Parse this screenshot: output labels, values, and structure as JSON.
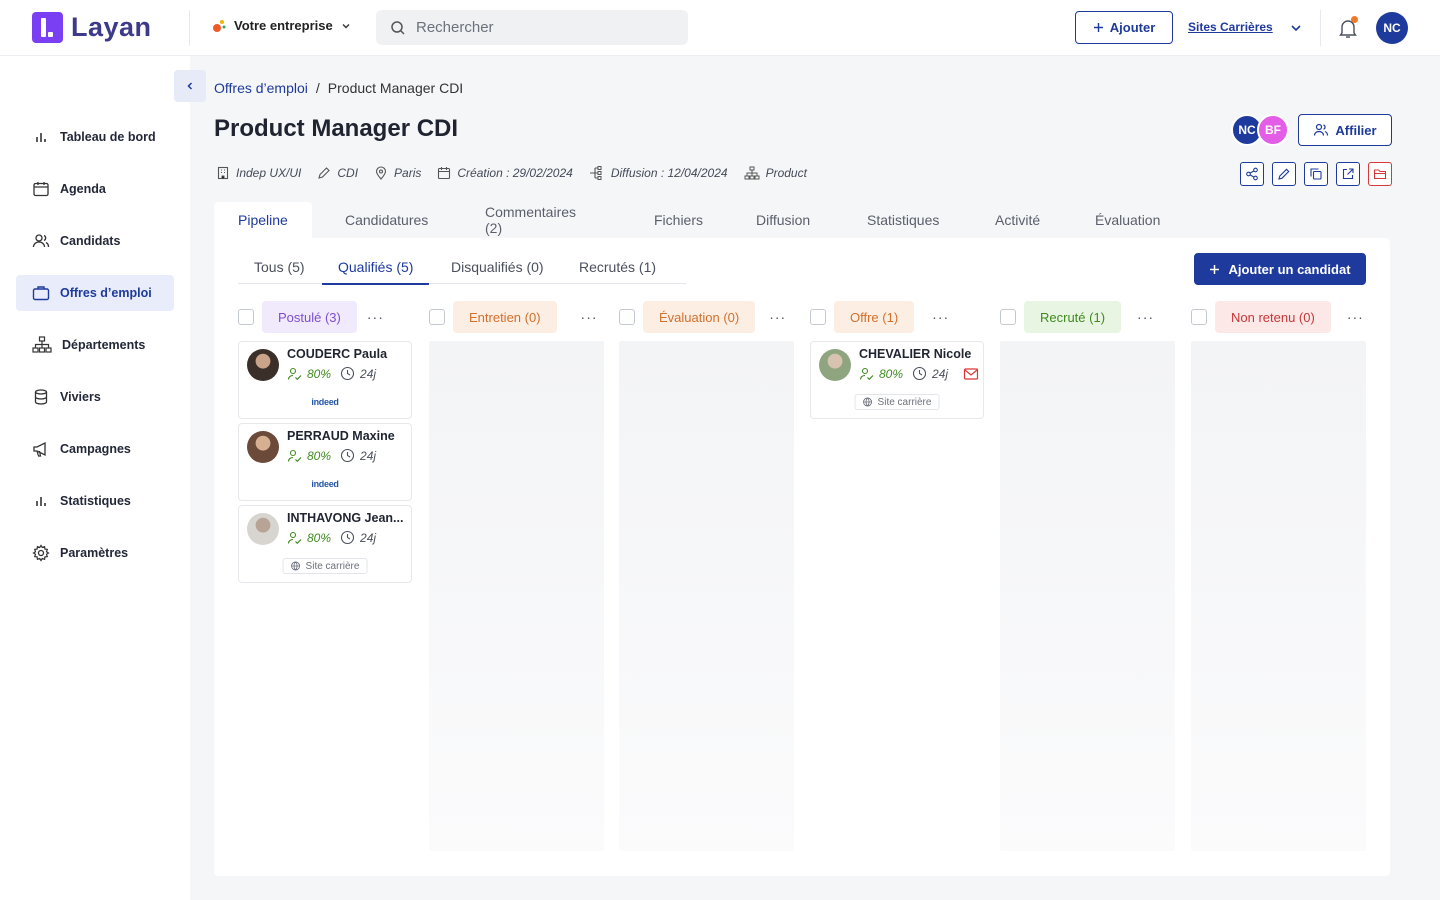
{
  "app": {
    "logo_text": "Layan",
    "brand_color": "#7a3ff2",
    "accent_color": "#1e3a9c"
  },
  "topbar": {
    "company": "Votre entreprise",
    "search_placeholder": "Rechercher",
    "add_label": "Ajouter",
    "sites_label": "Sites Carrières",
    "user_initials": "NC",
    "notification_dot": true
  },
  "sidebar": {
    "items": [
      {
        "label": "Tableau de bord",
        "icon": "bar-chart-icon"
      },
      {
        "label": "Agenda",
        "icon": "calendar-icon"
      },
      {
        "label": "Candidats",
        "icon": "users-icon"
      },
      {
        "label": "Offres d’emploi",
        "icon": "briefcase-icon",
        "active": true
      },
      {
        "label": "Départements",
        "icon": "org-chart-icon"
      },
      {
        "label": "Viviers",
        "icon": "database-icon"
      },
      {
        "label": "Campagnes",
        "icon": "megaphone-icon"
      },
      {
        "label": "Statistiques",
        "icon": "bar-chart-icon"
      },
      {
        "label": "Paramètres",
        "icon": "gear-icon"
      }
    ]
  },
  "breadcrumb": {
    "parent": "Offres d’emploi",
    "separator": "/",
    "current": "Product Manager CDI"
  },
  "job": {
    "title": "Product Manager CDI",
    "meta": {
      "team": "Indep UX/UI",
      "contract": "CDI",
      "location": "Paris",
      "creation": "Création : 29/02/2024",
      "diffusion": "Diffusion : 12/04/2024",
      "department": "Product"
    },
    "collaborators": [
      {
        "initials": "NC",
        "color": "#1e3a9c"
      },
      {
        "initials": "BF",
        "color": "#e35de6"
      }
    ],
    "affilier_label": "Affilier"
  },
  "tabs": [
    "Pipeline",
    "Candidatures",
    "Commentaires (2)",
    "Fichiers",
    "Diffusion",
    "Statistiques",
    "Activité",
    "Évaluation"
  ],
  "subtabs": [
    "Tous (5)",
    "Qualifiés (5)",
    "Disqualifiés (0)",
    "Recrutés (1)"
  ],
  "add_candidate_label": "Ajouter un candidat",
  "columns": [
    {
      "label": "Postulé (3)",
      "bg": "#f1e9fc",
      "fg": "#7d4fd0"
    },
    {
      "label": "Entretien (0)",
      "bg": "#fdeee3",
      "fg": "#d2702e"
    },
    {
      "label": "Évaluation (0)",
      "bg": "#fdeee3",
      "fg": "#d2702e"
    },
    {
      "label": "Offre (1)",
      "bg": "#fdeee3",
      "fg": "#d2702e"
    },
    {
      "label": "Recruté (1)",
      "bg": "#e9f5e3",
      "fg": "#3f8a1e"
    },
    {
      "label": "Non retenu (0)",
      "bg": "#fde8e8",
      "fg": "#c73737"
    }
  ],
  "cards": [
    {
      "name": "COUDERC Paula",
      "score": "80%",
      "days": "24j",
      "source": "indeed"
    },
    {
      "name": "PERRAUD Maxine",
      "score": "80%",
      "days": "24j",
      "source": "indeed"
    },
    {
      "name": "INTHAVONG Jean...",
      "score": "80%",
      "days": "24j",
      "source": "Site carrière"
    },
    {
      "name": "CHEVALIER Nicole",
      "score": "80%",
      "days": "24j",
      "source": "Site carrière"
    }
  ]
}
